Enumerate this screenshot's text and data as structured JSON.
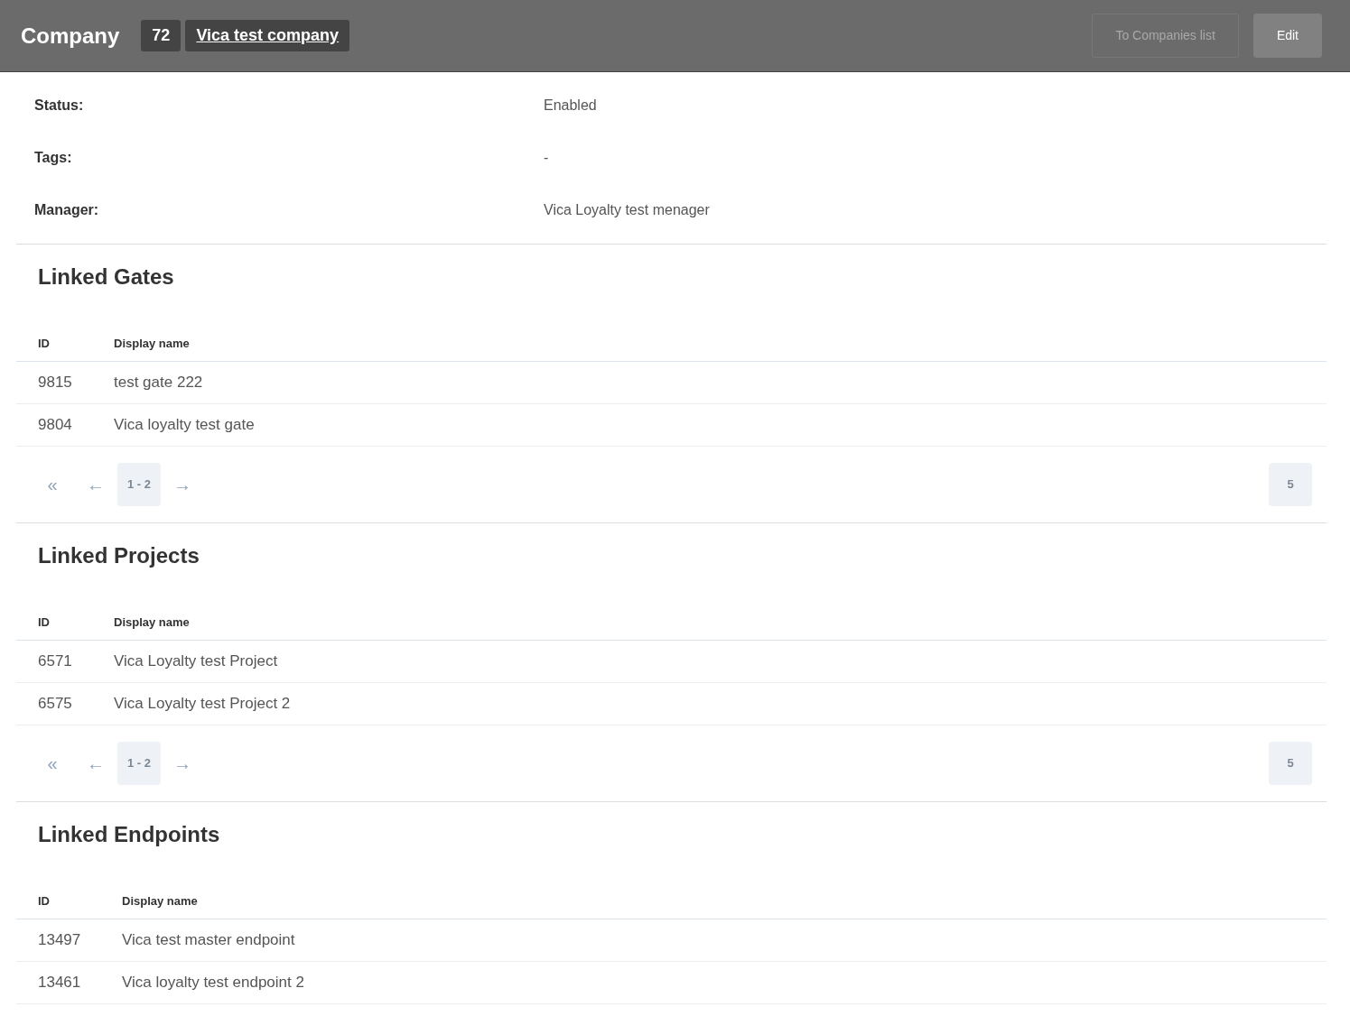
{
  "header": {
    "title": "Company",
    "id_badge": "72",
    "company_link": "Vica test company",
    "buttons": [
      {
        "label": "To Companies list",
        "disabled": true
      },
      {
        "label": "Edit",
        "disabled": false
      }
    ]
  },
  "fields": [
    {
      "label": "Status:",
      "value": "Enabled"
    },
    {
      "label": "Tags:",
      "value": "-"
    },
    {
      "label": "Manager:",
      "value": "Vica Loyalty test menager"
    }
  ],
  "sections": [
    {
      "title": "Linked Gates",
      "columns": [
        "ID",
        "Display name"
      ],
      "rows": [
        [
          "9815",
          "test gate 222"
        ],
        [
          "9804",
          "Vica loyalty test gate"
        ]
      ],
      "pager": {
        "nav": [
          {
            "label": "«",
            "disabled": true
          },
          {
            "label": "←",
            "disabled": true
          }
        ],
        "range": "1 - 2",
        "next": {
          "label": "→",
          "disabled": true
        },
        "page_size": "5"
      }
    },
    {
      "title": "Linked Projects",
      "columns": [
        "ID",
        "Display name"
      ],
      "rows": [
        [
          "6571",
          "Vica Loyalty test Project"
        ],
        [
          "6575",
          "Vica Loyalty test Project 2"
        ]
      ],
      "pager": {
        "nav": [
          {
            "label": "«",
            "disabled": true
          },
          {
            "label": "←",
            "disabled": true
          }
        ],
        "range": "1 - 2",
        "next": {
          "label": "→",
          "disabled": true
        },
        "page_size": "5"
      }
    },
    {
      "title": "Linked Endpoints",
      "columns": [
        "ID",
        "Display name"
      ],
      "rows": [
        [
          "13497",
          "Vica test master endpoint"
        ],
        [
          "13461",
          "Vica loyalty test endpoint 2"
        ]
      ]
    }
  ]
}
